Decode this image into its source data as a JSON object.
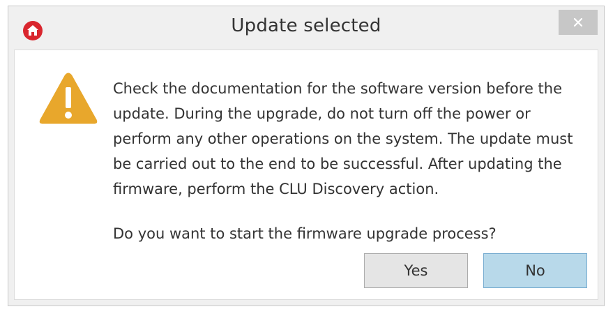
{
  "dialog": {
    "title": "Update selected",
    "app_icon": "home-icon",
    "close_icon": "close-icon",
    "close_glyph": "✕",
    "warning_icon": "warning-icon",
    "message": "Check the documentation for the software version before the update. During the upgrade, do not turn off the power or perform any other operations on the system. The update must be carried out to the end to be successful. After updating the firmware, perform the CLU Discovery action.",
    "question": "Do you want to start the firmware upgrade process?",
    "buttons": {
      "yes_label": "Yes",
      "no_label": "No"
    }
  },
  "colors": {
    "app_icon": "#d9262e",
    "warning": "#e8a72c",
    "titlebar_bg": "#f0f0f0",
    "close_button_bg": "#c7c7c7",
    "default_button_bg": "#b8d9ea",
    "default_button_border": "#77acd0",
    "text": "#333333"
  }
}
